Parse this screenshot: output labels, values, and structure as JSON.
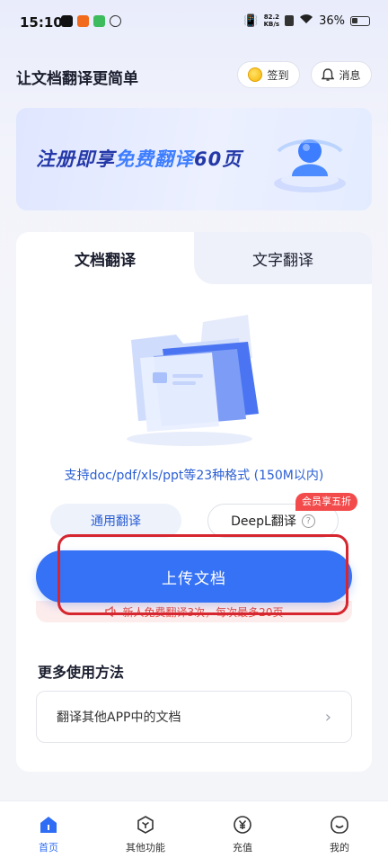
{
  "status_bar": {
    "time": "15:10",
    "speed_value": "82.2",
    "speed_unit": "KB/s",
    "battery": "36%"
  },
  "header": {
    "title": "让文档翻译更简单",
    "checkin_label": "签到",
    "message_label": "消息"
  },
  "banner": {
    "text_prefix": "注册即享",
    "text_highlight": "免费翻译",
    "text_suffix": "60页"
  },
  "tabs": {
    "doc": "文档翻译",
    "text": "文字翻译"
  },
  "upload": {
    "support_text": "支持doc/pdf/xls/ppt等23种格式 (150M以内)",
    "mode_general": "通用翻译",
    "mode_deepl": "DeepL翻译",
    "member_badge": "会员享五折",
    "button_label": "上传文档",
    "free_tip": "新人免费翻译3次，每次最多20页"
  },
  "more": {
    "title": "更多使用方法",
    "item_label": "翻译其他APP中的文档"
  },
  "bottom_nav": [
    {
      "label": "首页"
    },
    {
      "label": "其他功能"
    },
    {
      "label": "充值"
    },
    {
      "label": "我的"
    }
  ],
  "colors": {
    "accent": "#3572f5",
    "annotation": "#d6262f",
    "badge": "#f34b4b"
  }
}
